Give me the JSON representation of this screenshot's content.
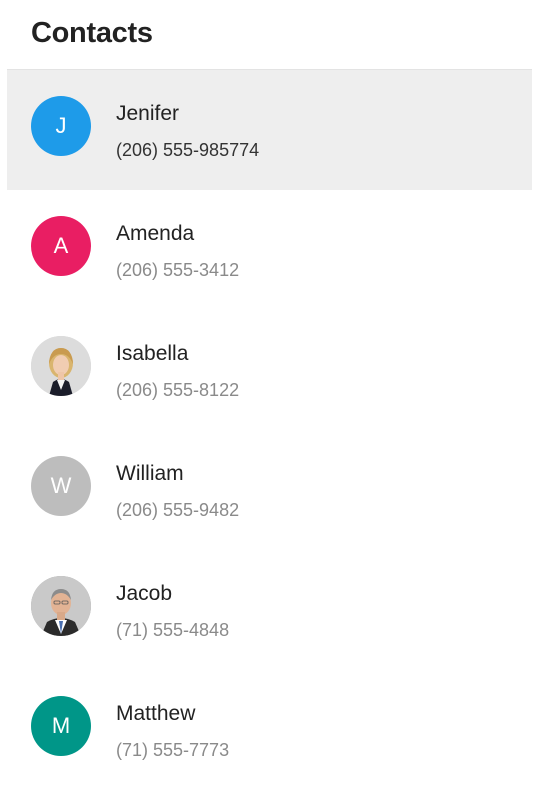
{
  "header": {
    "title": "Contacts"
  },
  "contacts": [
    {
      "name": "Jenifer",
      "phone": "(206) 555-985774",
      "initial": "J",
      "avatar_color": "#1e9be9",
      "avatar_type": "initial",
      "selected": true
    },
    {
      "name": "Amenda",
      "phone": "(206) 555-3412",
      "initial": "A",
      "avatar_color": "#e91e63",
      "avatar_type": "initial",
      "selected": false
    },
    {
      "name": "Isabella",
      "phone": "(206) 555-8122",
      "initial": "",
      "avatar_color": "#d9d9d9",
      "avatar_type": "photo-woman",
      "selected": false
    },
    {
      "name": "William",
      "phone": "(206) 555-9482",
      "initial": "W",
      "avatar_color": "#bdbdbd",
      "avatar_type": "initial",
      "selected": false
    },
    {
      "name": "Jacob",
      "phone": "(71) 555-4848",
      "initial": "",
      "avatar_color": "#9e9e9e",
      "avatar_type": "photo-man",
      "selected": false
    },
    {
      "name": "Matthew",
      "phone": "(71) 555-7773",
      "initial": "M",
      "avatar_color": "#009688",
      "avatar_type": "initial",
      "selected": false
    }
  ]
}
